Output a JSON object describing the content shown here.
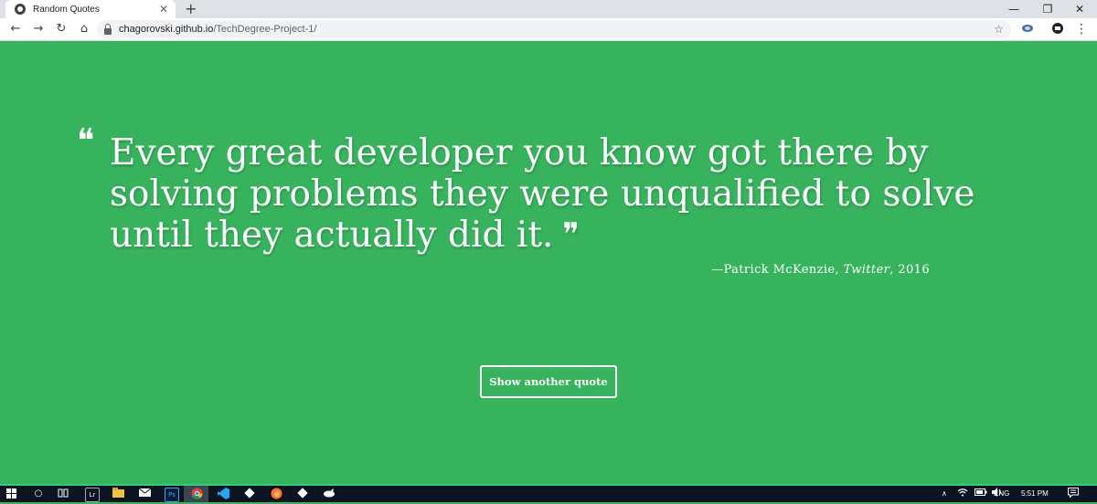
{
  "browser": {
    "tab_title": "Random Quotes",
    "tab_close": "✕",
    "new_tab": "+",
    "url_host": "chagorovski.github.io",
    "url_path": "/TechDegree-Project-1/",
    "window_controls": {
      "minimize": "—",
      "maximize": "❐",
      "close": "✕"
    },
    "nav": {
      "back": "←",
      "forward": "→",
      "reload": "↻",
      "home": "⌂"
    },
    "star": "☆",
    "menu": "⋮"
  },
  "page": {
    "background_color": "#36b35c",
    "quote": "Every great developer you know got there by solving problems they were unqualified to solve until they actually did it.",
    "quote_open_mark": "❝",
    "quote_close_mark": "❞",
    "source_name": "—Patrick McKenzie,",
    "citation": "Twitter",
    "year": ", 2016",
    "button_label": "Show another quote"
  },
  "taskbar": {
    "search_icon": "○",
    "apps": [
      "task-view-icon",
      "lr-icon",
      "file-explorer-icon",
      "mail-icon",
      "photoshop-icon",
      "chrome-icon",
      "vscode-icon",
      "git-icon",
      "firefox-icon",
      "git-bash-icon",
      "dolphin-icon"
    ],
    "lr_label": "Lr",
    "ps_label": "Ps",
    "tray": {
      "chevron": "∧",
      "language": "ENG",
      "time": "5:51 PM"
    }
  }
}
